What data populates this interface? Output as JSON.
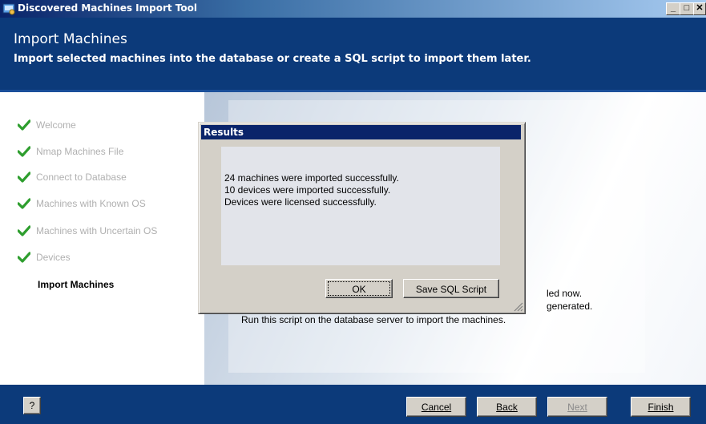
{
  "window": {
    "title": "Discovered Machines Import Tool",
    "minimize_label": "_",
    "maximize_label": "□",
    "close_label": "✕"
  },
  "header": {
    "title": "Import Machines",
    "subtitle": "Import selected machines into the database or create a SQL script to import them later."
  },
  "steps": [
    {
      "label": "Welcome",
      "status": "done"
    },
    {
      "label": "Nmap Machines File",
      "status": "done"
    },
    {
      "label": "Connect to Database",
      "status": "done"
    },
    {
      "label": "Machines with Known OS",
      "status": "done"
    },
    {
      "label": "Machines with Uncertain OS",
      "status": "done"
    },
    {
      "label": "Devices",
      "status": "done"
    },
    {
      "label": "Import Machines",
      "status": "current"
    }
  ],
  "background_text": {
    "line1_partial": "led now.",
    "line2_partial": "generated.",
    "line3": "Run this script on the database server to import the machines."
  },
  "dialog": {
    "title": "Results",
    "messages": [
      "24 machines were imported successfully.",
      "10 devices were imported successfully.",
      "Devices were licensed successfully."
    ],
    "ok_label": "OK",
    "save_label": "Save SQL Script"
  },
  "footer": {
    "help_label": "?",
    "cancel_label": "Cancel",
    "back_label": "Back",
    "next_label": "Next",
    "finish_label": "Finish"
  },
  "colors": {
    "header_bg": "#0c3a7a",
    "check_green": "#2e9e2e",
    "dialog_title_bg": "#0a246a"
  }
}
